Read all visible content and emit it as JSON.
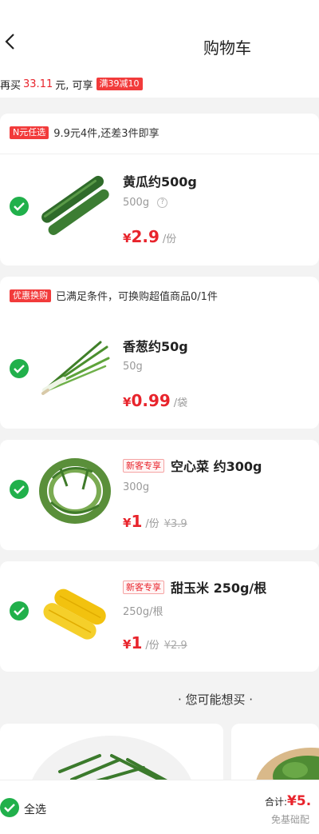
{
  "header": {
    "title": "购物车"
  },
  "promo_bar": {
    "prefix": "再买",
    "amount": "33.11",
    "suffix": "元, 可享",
    "tag": "满39减10"
  },
  "group1": {
    "tag": "N元任选",
    "desc": "9.9元4件,还差3件即享",
    "item": {
      "name": "黄瓜约500g",
      "spec": "500g",
      "help": "?",
      "currency": "¥",
      "price": "2.9",
      "unit": "/份"
    }
  },
  "group2": {
    "tag": "优惠换购",
    "desc": "已满足条件，可换购超值商品0/1件",
    "item": {
      "name": "香葱约50g",
      "spec": "50g",
      "currency": "¥",
      "price": "0.99",
      "unit": "/袋"
    }
  },
  "group3": {
    "item": {
      "tag": "新客专享",
      "name": "空心菜 约300g",
      "spec": "300g",
      "currency": "¥",
      "price": "1",
      "unit": "/份",
      "orig": "¥3.9"
    }
  },
  "group4": {
    "item": {
      "tag": "新客专享",
      "name": "甜玉米 250g/根",
      "spec": "250g/根",
      "currency": "¥",
      "price": "1",
      "unit": "/份",
      "orig": "¥2.9"
    }
  },
  "recommend": {
    "title": "· 您可能想买 ·"
  },
  "bottom": {
    "select_all": "全选",
    "total_label": "合计:",
    "total_amount": "¥5.",
    "fee_note": "免基础配"
  },
  "colors": {
    "accent_red": "#e8242c",
    "check_green": "#21b04b"
  }
}
